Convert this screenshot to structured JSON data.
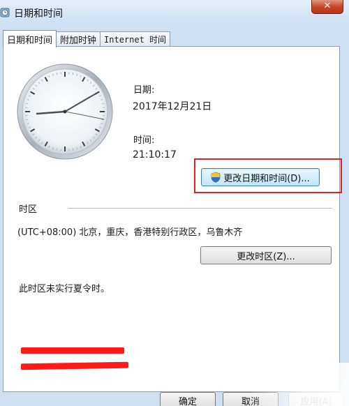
{
  "window": {
    "title": "日期和时间",
    "icon": "clock-app-icon",
    "close_glyph": "✕"
  },
  "tabs": [
    {
      "label": "日期和时间",
      "active": true
    },
    {
      "label": "附加时钟",
      "active": false
    },
    {
      "label": "Internet 时间",
      "active": false
    }
  ],
  "date": {
    "label": "日期:",
    "value": "2017年12月21日"
  },
  "time": {
    "label": "时间:",
    "value": "21:10:17"
  },
  "change_datetime_button": {
    "label": "更改日期和时间(D)...",
    "icon": "uac-shield-icon"
  },
  "timezone": {
    "heading": "时区",
    "value": "(UTC+08:00) 北京，重庆，香港特别行政区，乌鲁木齐",
    "change_button_label": "更改时区(Z)...",
    "dst_note": "此时区未实行夏令时。"
  },
  "dialog_buttons": {
    "ok": "确定",
    "cancel": "取消",
    "apply": "应用(A)"
  },
  "colors": {
    "highlight_box": "#e2211c",
    "redaction": "#ff1a1a"
  }
}
